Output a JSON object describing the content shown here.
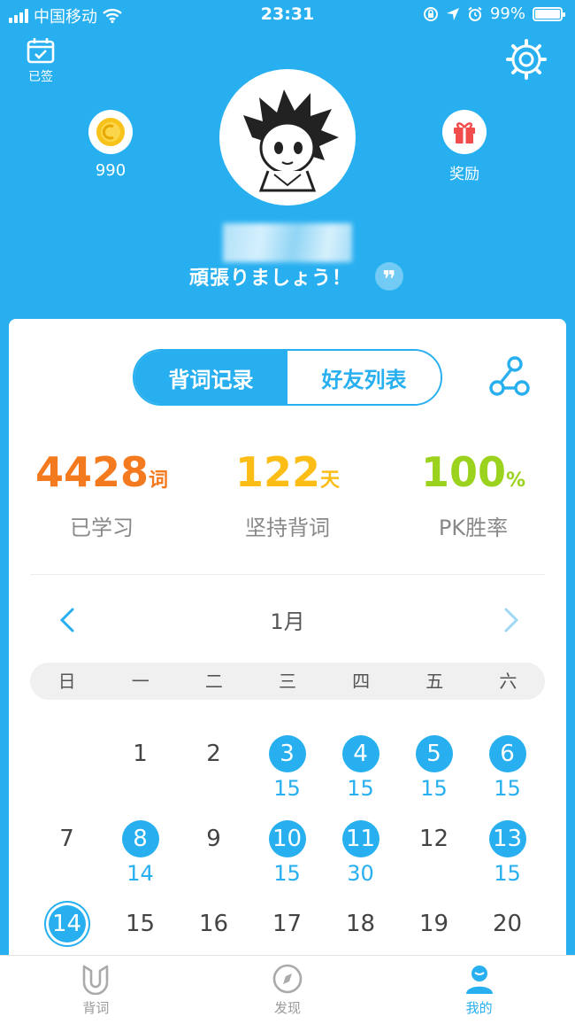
{
  "status_bar": {
    "carrier": "中国移动",
    "time": "23:31",
    "battery": "99%",
    "battery_level": 0.99
  },
  "header": {
    "signed_label": "已签",
    "coins_value": "990",
    "reward_label": "奖励",
    "motto": "頑張りましょう！",
    "quote_glyph": "❞"
  },
  "segment": {
    "tab_records": "背词记录",
    "tab_friends": "好友列表",
    "active": "tab_records"
  },
  "stats": [
    {
      "value": "4428",
      "unit": "词",
      "label": "已学习",
      "color": "#f47a1f"
    },
    {
      "value": "122",
      "unit": "天",
      "label": "坚持背词",
      "color": "#fbbd16"
    },
    {
      "value": "100",
      "unit": "%",
      "label": "PK胜率",
      "color": "#9bd21e"
    }
  ],
  "calendar": {
    "month": "1月",
    "weekdays": [
      "日",
      "一",
      "二",
      "三",
      "四",
      "五",
      "六"
    ],
    "days": [
      {
        "d": "1",
        "col": 1,
        "row": 0,
        "words": ""
      },
      {
        "d": "2",
        "col": 2,
        "row": 0,
        "words": ""
      },
      {
        "d": "3",
        "col": 3,
        "row": 0,
        "words": "15",
        "done": true
      },
      {
        "d": "4",
        "col": 4,
        "row": 0,
        "words": "15",
        "done": true
      },
      {
        "d": "5",
        "col": 5,
        "row": 0,
        "words": "15",
        "done": true
      },
      {
        "d": "6",
        "col": 6,
        "row": 0,
        "words": "15",
        "done": true
      },
      {
        "d": "7",
        "col": 0,
        "row": 1,
        "words": ""
      },
      {
        "d": "8",
        "col": 1,
        "row": 1,
        "words": "14",
        "done": true
      },
      {
        "d": "9",
        "col": 2,
        "row": 1,
        "words": ""
      },
      {
        "d": "10",
        "col": 3,
        "row": 1,
        "words": "15",
        "done": true
      },
      {
        "d": "11",
        "col": 4,
        "row": 1,
        "words": "30",
        "done": true
      },
      {
        "d": "12",
        "col": 5,
        "row": 1,
        "words": ""
      },
      {
        "d": "13",
        "col": 6,
        "row": 1,
        "words": "15",
        "done": true
      },
      {
        "d": "14",
        "col": 0,
        "row": 2,
        "words": "",
        "today": true
      },
      {
        "d": "15",
        "col": 1,
        "row": 2,
        "words": ""
      },
      {
        "d": "16",
        "col": 2,
        "row": 2,
        "words": ""
      },
      {
        "d": "17",
        "col": 3,
        "row": 2,
        "words": ""
      },
      {
        "d": "18",
        "col": 4,
        "row": 2,
        "words": ""
      },
      {
        "d": "19",
        "col": 5,
        "row": 2,
        "words": ""
      },
      {
        "d": "20",
        "col": 6,
        "row": 2,
        "words": ""
      }
    ]
  },
  "tabbar": {
    "tab_study": "背词",
    "tab_discover": "发现",
    "tab_mine": "我的",
    "active": "tab_mine"
  },
  "colors": {
    "accent": "#27aff0",
    "coin": "#f7c21a",
    "gift": "#f24b4b"
  }
}
